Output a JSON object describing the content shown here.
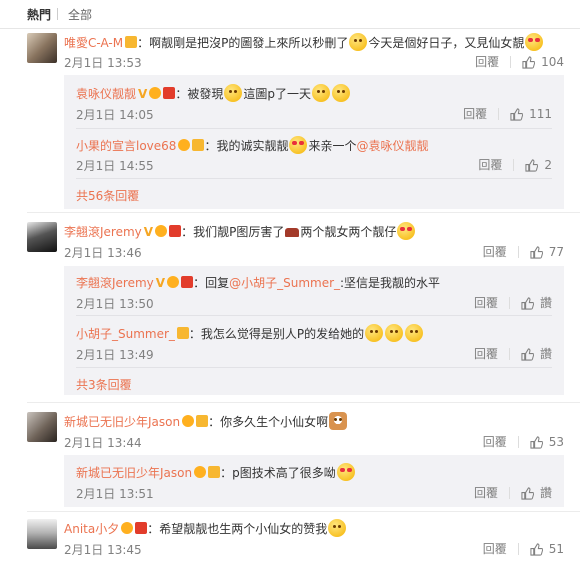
{
  "tabs": {
    "hot": "熱門",
    "all": "全部"
  },
  "comments": [
    {
      "user": "唯愛C-A-M",
      "text_a": "：啊靓剛是把沒P的圖發上來所以秒刪了",
      "text_b": "今天是個好日子，又見仙女靚",
      "time": "2月1日 13:53",
      "reply": "回覆",
      "likes": "104",
      "replies": [
        {
          "user": "袁咏仪靓靓",
          "text_a": "：被發現",
          "text_b": "這圖p了一天",
          "time": "2月1日 14:05",
          "reply": "回覆",
          "likes": "111"
        },
        {
          "user": "小果的宣言love68",
          "text_a": "：我的诚实靓靓",
          "text_b": "来亲一个",
          "mention": "@袁咏仪靓靓",
          "time": "2月1日 14:55",
          "reply": "回覆",
          "likes": "2"
        }
      ],
      "more": "共56条回覆"
    },
    {
      "user": "李翹滾Jeremy",
      "text_a": "：我们靓P图厉害了",
      "text_b": "两个靓女两个靓仔",
      "time": "2月1日 13:46",
      "reply": "回覆",
      "likes": "77",
      "replies": [
        {
          "user": "李翹滾Jeremy",
          "text_a": "：回复",
          "mention": "@小胡子_Summer_",
          "text_b": ":坚信是我靓的水平",
          "time": "2月1日 13:50",
          "reply": "回覆",
          "likes": "讚"
        },
        {
          "user": "小胡子_Summer_",
          "text_a": "：我怎么觉得是别人P的发给她的",
          "time": "2月1日 13:49",
          "reply": "回覆",
          "likes": "讚"
        }
      ],
      "more": "共3条回覆"
    },
    {
      "user": "新城已无旧少年Jason",
      "text_a": "：你多久生个小仙女啊",
      "time": "2月1日 13:44",
      "reply": "回覆",
      "likes": "53",
      "replies": [
        {
          "user": "新城已无旧少年Jason",
          "text_a": "：p图技术高了很多呦",
          "time": "2月1日 13:51",
          "reply": "回覆",
          "likes": "讚"
        }
      ]
    },
    {
      "user": "Anita小夕",
      "text_a": "：希望靓靓也生两个小仙女的赞我",
      "time": "2月1日 13:45",
      "reply": "回覆",
      "likes": "51"
    }
  ]
}
